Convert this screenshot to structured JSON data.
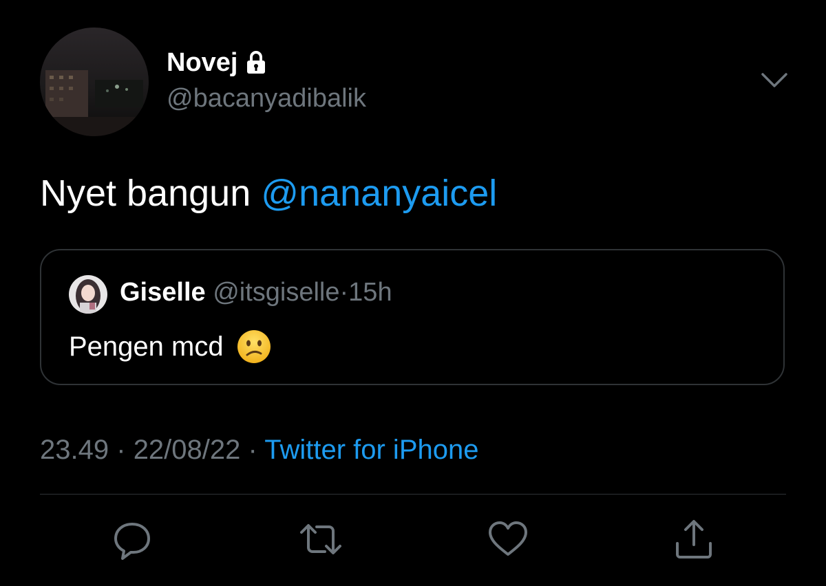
{
  "tweet": {
    "author": {
      "display_name": "Novej",
      "handle": "@bacanyadibalik",
      "protected_icon": "lock-icon"
    },
    "more_icon": "chevron-down-icon",
    "text": "Nyet bangun",
    "mention": "@nananyaicel",
    "quoted": {
      "display_name": "Giselle",
      "handle": "@itsgiselle",
      "separator": "·",
      "time": "15h",
      "text": "Pengen mcd",
      "emoji_icon": "slightly-frowning-face-emoji"
    },
    "meta": {
      "time": "23.49",
      "sep1": "·",
      "date": "22/08/22",
      "sep2": "·",
      "source": "Twitter for iPhone"
    },
    "actions": {
      "reply_icon": "reply-icon",
      "retweet_icon": "retweet-icon",
      "like_icon": "heart-icon",
      "share_icon": "share-icon"
    }
  },
  "colors": {
    "background": "#000000",
    "text_primary": "#ffffff",
    "text_secondary": "#6e767d",
    "accent": "#1d9bf0",
    "border": "#2f3336"
  }
}
